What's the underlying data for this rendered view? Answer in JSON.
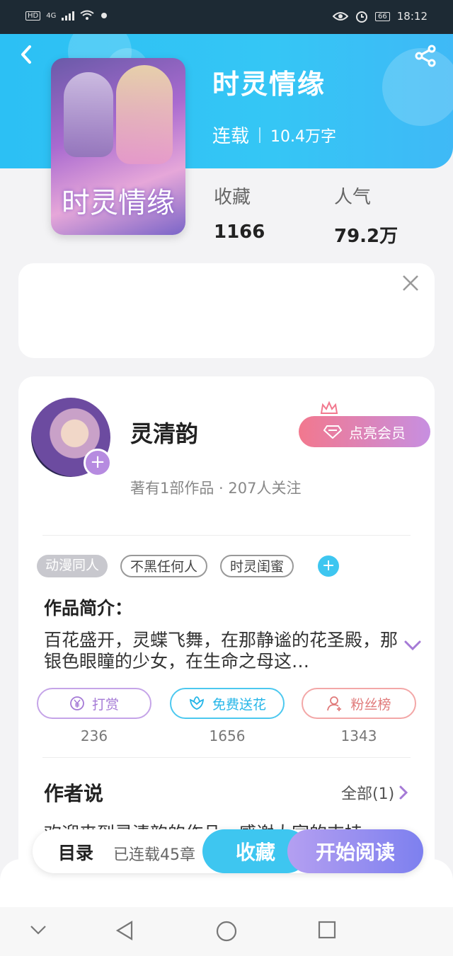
{
  "status_bar": {
    "hd": "HD",
    "net": "4G",
    "battery": "66",
    "time": "18:12"
  },
  "book": {
    "title": "时灵情缘",
    "cover_text": "时灵情缘",
    "status": "连载",
    "words": "10.4万字",
    "favorites_label": "收藏",
    "favorites_value": "1166",
    "popularity_label": "人气",
    "popularity_value": "79.2万"
  },
  "author": {
    "name": "灵清韵",
    "info": "著有1部作品 · 207人关注",
    "vip_label": "点亮会员"
  },
  "tags": [
    "动漫同人",
    "不黑任何人",
    "时灵闺蜜"
  ],
  "intro": {
    "title": "作品简介：",
    "text": "百花盛开，灵蝶飞舞，在那静谧的花圣殿，那银色眼瞳的少女，在生命之母这…"
  },
  "actions": {
    "tip_label": "打赏",
    "tip_count": "236",
    "flower_label": "免费送花",
    "flower_count": "1656",
    "fans_label": "粉丝榜",
    "fans_count": "1343"
  },
  "author_says": {
    "title": "作者说",
    "all_label": "全部(1)",
    "peek": "欢迎来到灵清韵的作品，感谢大家的支持…"
  },
  "bottom": {
    "toc": "目录",
    "serial": "已连载45章",
    "favorite": "收藏",
    "read": "开始阅读"
  },
  "colors": {
    "header_blue": "#35c6f5",
    "vip_gradient_start": "#f2788e",
    "vip_gradient_end": "#c78fe1",
    "read_gradient_end": "#7d80ef"
  }
}
